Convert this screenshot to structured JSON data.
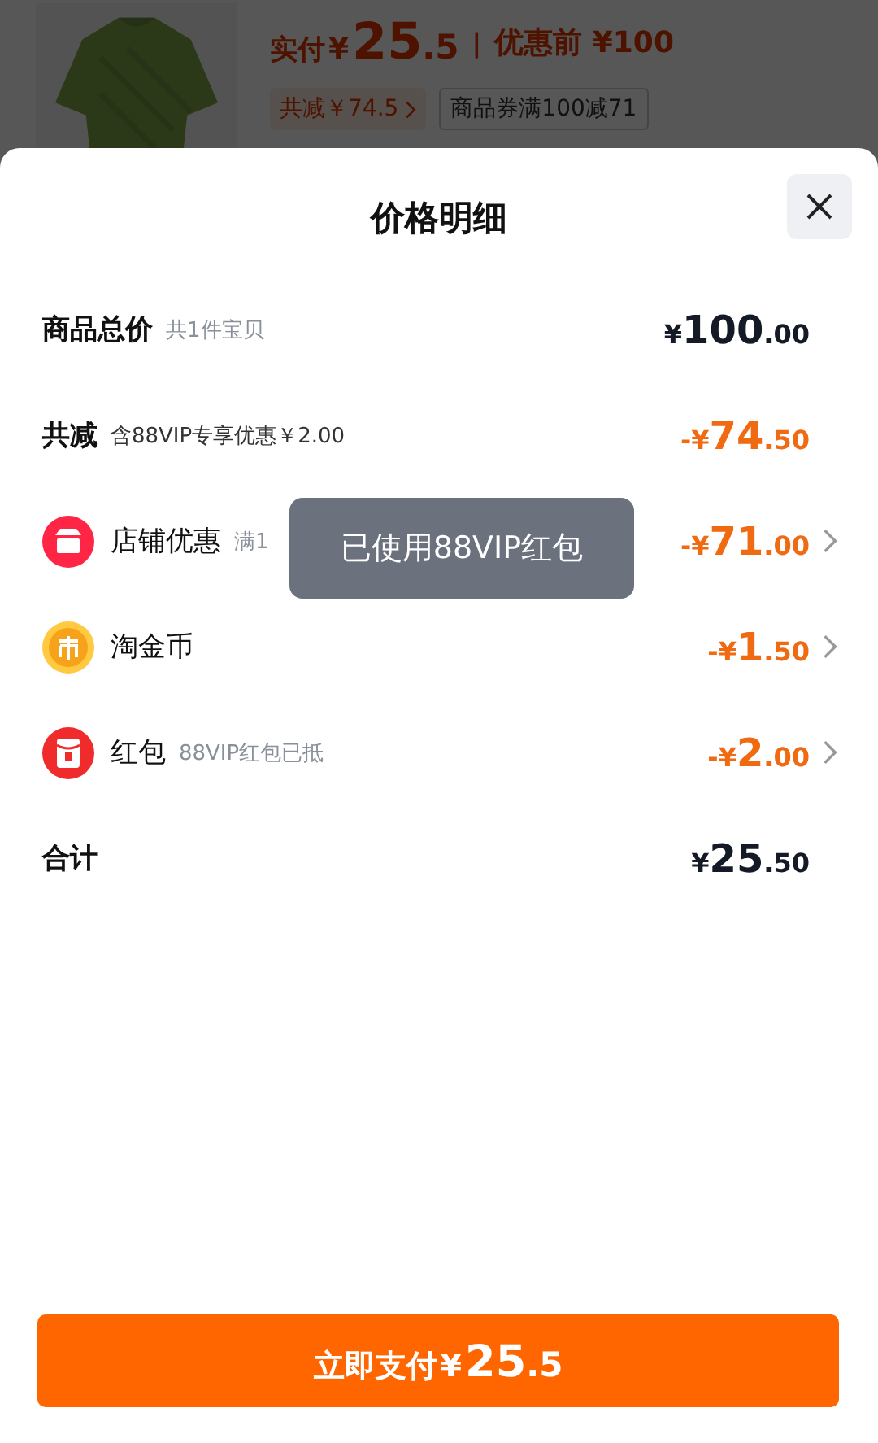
{
  "product_header": {
    "paid_label": "实付",
    "paid_currency": "¥",
    "paid_integer": "25",
    "paid_decimal": ".5",
    "separator": "|",
    "original_price": "优惠前 ¥100",
    "tags": [
      {
        "label": "共减￥74.5",
        "kind": "link"
      },
      {
        "label": "商品券满100减71",
        "kind": "plain"
      }
    ]
  },
  "sheet": {
    "title": "价格明细"
  },
  "rows": [
    {
      "kind": "total",
      "label": "商品总价",
      "note": "共1件宝贝",
      "prefix": "¥",
      "integer": "100",
      "decimal": ".00",
      "expandable": false
    },
    {
      "kind": "discount",
      "label": "共减",
      "note": "含88VIP专享优惠￥2.00",
      "prefix": "-¥",
      "integer": "74",
      "decimal": ".50",
      "expandable": false
    },
    {
      "kind": "shop",
      "label": "店铺优惠",
      "note": "满1",
      "prefix": "-¥",
      "integer": "71",
      "decimal": ".00",
      "expandable": true
    },
    {
      "kind": "coin",
      "label": "淘金币",
      "prefix": "-¥",
      "integer": "1",
      "decimal": ".50",
      "expandable": true
    },
    {
      "kind": "envelope",
      "label": "红包",
      "note": "88VIP红包已抵",
      "prefix": "-¥",
      "integer": "2",
      "decimal": ".00",
      "expandable": true
    },
    {
      "kind": "sum",
      "label": "合计",
      "prefix": "¥",
      "integer": "25",
      "decimal": ".50",
      "expandable": false
    }
  ],
  "toast": "已使用88VIP红包",
  "pay_button": {
    "label": "立即支付",
    "currency": "¥",
    "integer": "25",
    "decimal": ".5"
  }
}
